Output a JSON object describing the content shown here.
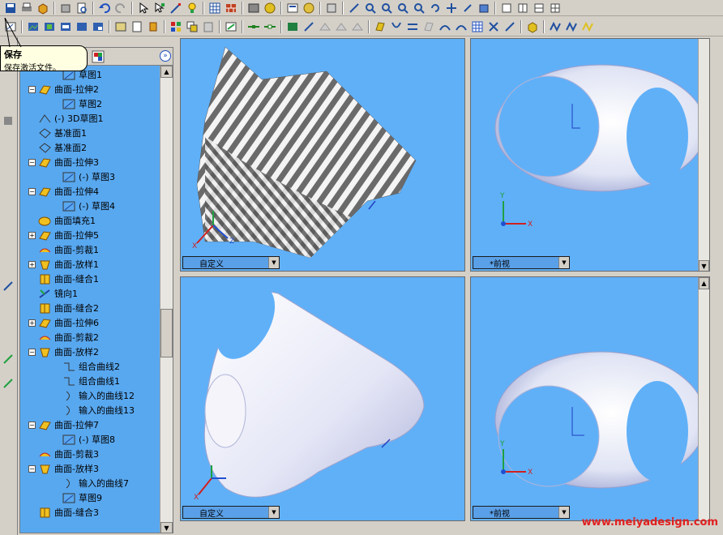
{
  "tooltip": {
    "title": "保存",
    "description": "保存激活文件。"
  },
  "tree": {
    "items": [
      {
        "label": "草图1",
        "indent": 2,
        "icon": "sketch-icon",
        "expander": ""
      },
      {
        "label": "曲面-拉伸2",
        "indent": 1,
        "icon": "surface-extrude-icon",
        "expander": "−"
      },
      {
        "label": "草图2",
        "indent": 2,
        "icon": "sketch-icon",
        "expander": ""
      },
      {
        "label": "(-) 3D草图1",
        "indent": 1,
        "icon": "3d-sketch-icon",
        "expander": ""
      },
      {
        "label": "基准面1",
        "indent": 1,
        "icon": "plane-icon",
        "expander": ""
      },
      {
        "label": "基准面2",
        "indent": 1,
        "icon": "plane-icon",
        "expander": ""
      },
      {
        "label": "曲面-拉伸3",
        "indent": 1,
        "icon": "surface-extrude-icon",
        "expander": "−"
      },
      {
        "label": "(-) 草图3",
        "indent": 2,
        "icon": "sketch-icon",
        "expander": ""
      },
      {
        "label": "曲面-拉伸4",
        "indent": 1,
        "icon": "surface-extrude-icon",
        "expander": "−"
      },
      {
        "label": "(-) 草图4",
        "indent": 2,
        "icon": "sketch-icon",
        "expander": ""
      },
      {
        "label": "曲面填充1",
        "indent": 1,
        "icon": "surface-fill-icon",
        "expander": ""
      },
      {
        "label": "曲面-拉伸5",
        "indent": 1,
        "icon": "surface-extrude-icon",
        "expander": "+"
      },
      {
        "label": "曲面-剪裁1",
        "indent": 1,
        "icon": "surface-trim-icon",
        "expander": ""
      },
      {
        "label": "曲面-放样1",
        "indent": 1,
        "icon": "surface-loft-icon",
        "expander": "+"
      },
      {
        "label": "曲面-缝合1",
        "indent": 1,
        "icon": "surface-knit-icon",
        "expander": ""
      },
      {
        "label": "镜向1",
        "indent": 1,
        "icon": "mirror-icon",
        "expander": ""
      },
      {
        "label": "曲面-缝合2",
        "indent": 1,
        "icon": "surface-knit-icon",
        "expander": ""
      },
      {
        "label": "曲面-拉伸6",
        "indent": 1,
        "icon": "surface-extrude-icon",
        "expander": "+"
      },
      {
        "label": "曲面-剪裁2",
        "indent": 1,
        "icon": "surface-trim-icon",
        "expander": ""
      },
      {
        "label": "曲面-放样2",
        "indent": 1,
        "icon": "surface-loft-icon",
        "expander": "−"
      },
      {
        "label": "组合曲线2",
        "indent": 2,
        "icon": "composite-curve-icon",
        "expander": ""
      },
      {
        "label": "组合曲线1",
        "indent": 2,
        "icon": "composite-curve-icon",
        "expander": ""
      },
      {
        "label": "输入的曲线12",
        "indent": 2,
        "icon": "curve-icon",
        "expander": ""
      },
      {
        "label": "输入的曲线13",
        "indent": 2,
        "icon": "curve-icon",
        "expander": ""
      },
      {
        "label": "曲面-拉伸7",
        "indent": 1,
        "icon": "surface-extrude-icon",
        "expander": "−"
      },
      {
        "label": "(-) 草图8",
        "indent": 2,
        "icon": "sketch-icon",
        "expander": ""
      },
      {
        "label": "曲面-剪裁3",
        "indent": 1,
        "icon": "surface-trim-icon",
        "expander": ""
      },
      {
        "label": "曲面-放样3",
        "indent": 1,
        "icon": "surface-loft-icon",
        "expander": "−"
      },
      {
        "label": "输入的曲线7",
        "indent": 2,
        "icon": "curve-icon",
        "expander": ""
      },
      {
        "label": "草图9",
        "indent": 2,
        "icon": "sketch-icon",
        "expander": ""
      },
      {
        "label": "曲面-缝合3",
        "indent": 1,
        "icon": "surface-knit-icon",
        "expander": ""
      }
    ]
  },
  "viewports": {
    "top_left": {
      "view": "自定义"
    },
    "top_right": {
      "view": "*前视"
    },
    "bottom_left": {
      "view": "自定义"
    },
    "bottom_right": {
      "view": "*前视"
    }
  },
  "axes": {
    "x": "X",
    "y": "Y",
    "z": "Z"
  },
  "watermark": "www.meiyadesign.com",
  "colors": {
    "viewport_bg": "#60b0f8",
    "tree_bg": "#58a8f0",
    "tooltip_bg": "#ffffe1",
    "watermark": "#e02020"
  }
}
